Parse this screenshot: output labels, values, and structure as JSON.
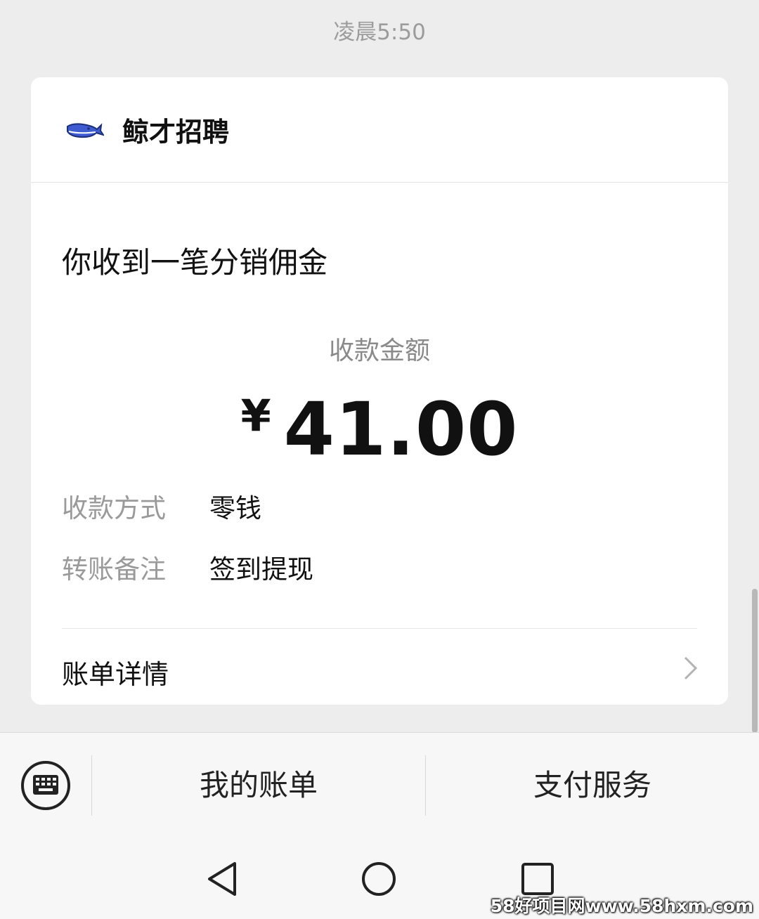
{
  "chat": {
    "timestamp": "凌晨5:50"
  },
  "card": {
    "brand_name": "鲸才招聘",
    "brand_icon": "whale-logo-icon",
    "title": "你收到一笔分销佣金",
    "amount_label": "收款金额",
    "currency_symbol": "¥",
    "amount": "41.00",
    "fields": [
      {
        "key": "收款方式",
        "value": "零钱"
      },
      {
        "key": "转账备注",
        "value": "签到提现"
      }
    ],
    "detail_link": "账单详情"
  },
  "bottom_menu": {
    "keyboard_icon": "keyboard-icon",
    "items": [
      "我的账单",
      "支付服务"
    ]
  },
  "navbar": {
    "icons": [
      "back-triangle-icon",
      "home-circle-icon",
      "recents-square-icon"
    ]
  },
  "watermark": "58好项目网www.58hxm.com",
  "colors": {
    "background": "#ededed",
    "card": "#ffffff",
    "muted_text": "#9a9a9a",
    "whale_blue": "#3e5ccf"
  }
}
